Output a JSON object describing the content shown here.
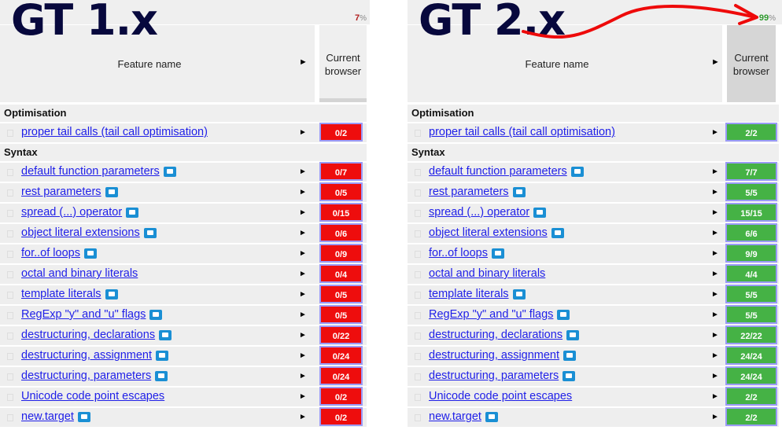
{
  "panels": [
    {
      "title": "GT 1.x",
      "score": "7",
      "score_pct": "%",
      "score_color": "#b01c1c",
      "header": {
        "feature_name": "Feature name",
        "column": "Current browser"
      },
      "status": "no",
      "categories": [
        {
          "name": "Optimisation",
          "rows": [
            {
              "label": "proper tail calls (tail call optimisation)",
              "note": false,
              "result": "0/2"
            }
          ]
        },
        {
          "name": "Syntax",
          "rows": [
            {
              "label": "default function parameters",
              "note": true,
              "result": "0/7"
            },
            {
              "label": "rest parameters",
              "note": true,
              "result": "0/5"
            },
            {
              "label": "spread (...) operator",
              "note": true,
              "result": "0/15"
            },
            {
              "label": "object literal extensions",
              "note": true,
              "result": "0/6"
            },
            {
              "label": "for..of loops",
              "note": true,
              "result": "0/9"
            },
            {
              "label": "octal and binary literals",
              "note": false,
              "result": "0/4"
            },
            {
              "label": "template literals",
              "note": true,
              "result": "0/5"
            },
            {
              "label": "RegExp \"y\" and \"u\" flags",
              "note": true,
              "result": "0/5"
            },
            {
              "label": "destructuring, declarations",
              "note": true,
              "result": "0/22"
            },
            {
              "label": "destructuring, assignment",
              "note": true,
              "result": "0/24"
            },
            {
              "label": "destructuring, parameters",
              "note": true,
              "result": "0/24"
            },
            {
              "label": "Unicode code point escapes",
              "note": false,
              "result": "0/2"
            },
            {
              "label": "new.target",
              "note": true,
              "result": "0/2"
            }
          ]
        }
      ]
    },
    {
      "title": "GT 2.x",
      "score": "99",
      "score_pct": "%",
      "score_color": "#2e9a2e",
      "header": {
        "feature_name": "Feature name",
        "column": "Current browser"
      },
      "status": "yes",
      "categories": [
        {
          "name": "Optimisation",
          "rows": [
            {
              "label": "proper tail calls (tail call optimisation)",
              "note": false,
              "result": "2/2"
            }
          ]
        },
        {
          "name": "Syntax",
          "rows": [
            {
              "label": "default function parameters",
              "note": true,
              "result": "7/7"
            },
            {
              "label": "rest parameters",
              "note": true,
              "result": "5/5"
            },
            {
              "label": "spread (...) operator",
              "note": true,
              "result": "15/15"
            },
            {
              "label": "object literal extensions",
              "note": true,
              "result": "6/6"
            },
            {
              "label": "for..of loops",
              "note": true,
              "result": "9/9"
            },
            {
              "label": "octal and binary literals",
              "note": false,
              "result": "4/4"
            },
            {
              "label": "template literals",
              "note": true,
              "result": "5/5"
            },
            {
              "label": "RegExp \"y\" and \"u\" flags",
              "note": true,
              "result": "5/5"
            },
            {
              "label": "destructuring, declarations",
              "note": true,
              "result": "22/22"
            },
            {
              "label": "destructuring, assignment",
              "note": true,
              "result": "24/24"
            },
            {
              "label": "destructuring, parameters",
              "note": true,
              "result": "24/24"
            },
            {
              "label": "Unicode code point escapes",
              "note": false,
              "result": "2/2"
            },
            {
              "label": "new.target",
              "note": true,
              "result": "2/2"
            }
          ]
        }
      ]
    }
  ],
  "colors": {
    "fail": "#ee0d0d",
    "pass": "#45b245",
    "link": "#2020e8",
    "annotation_arrow": "#ee0a0a",
    "title": "#07083d"
  },
  "arrow_glyph": "►"
}
